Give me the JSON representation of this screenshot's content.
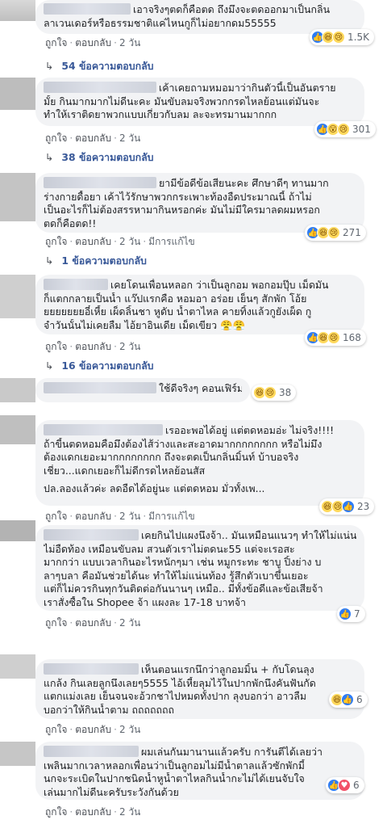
{
  "comments": [
    {
      "lines": [
        "เอาจริงๆตดก็คือตด ถึงมึงจะตดออกมาเป็นกลิ่น",
        "ลาเวนเดอร์หรือธรรมชาติแค่ไหนกูก็ไม่อยากดม55555"
      ],
      "actions": {
        "like": "ถูกใจ",
        "reply": "ตอบกลับ",
        "time": "2 วัน",
        "edited": ""
      },
      "reaction_count": "1.5K",
      "reactions": [
        "like",
        "haha",
        "sad"
      ],
      "replies": "54 ข้อความตอบกลับ"
    },
    {
      "lines": [
        "เค้าเคยถามหมอมาว่ากินตัวนี้เป็นอันตราย",
        "มั้ย กินมากมากไม่ดีนะคะ มันขับลมจริงพวกกรดไหลย้อนแต่มันจะ",
        "ทำให้เราติดยาพวกแบบเกี่ยวกับลม ละจะทรมานมากกก"
      ],
      "actions": {
        "like": "ถูกใจ",
        "reply": "ตอบกลับ",
        "time": "2 วัน",
        "edited": ""
      },
      "reaction_count": "301",
      "reactions": [
        "like",
        "wow",
        "sad"
      ],
      "replies": "38 ข้อความตอบกลับ"
    },
    {
      "lines": [
        "ยามีข้อดีข้อเสียนะคะ ศึกษาดีๆ ทานมาก",
        "ร่างกายดื้อยา เค้าไว้รักษาพวกกระเพาะท้องอืดประมาณนี้ ถ้าไม่",
        "เป็นอะไรก็ไม่ต้องสรรหามากินหรอกค่ะ มันไม่มีใครมาลดผมหรอก",
        "ตดก็คือตด!!"
      ],
      "actions": {
        "like": "ถูกใจ",
        "reply": "ตอบกลับ",
        "time": "2 วัน",
        "edited": "มีการแก้ไข"
      },
      "reaction_count": "271",
      "reactions": [
        "like",
        "haha",
        "sad"
      ],
      "replies": "1 ข้อความตอบกลับ"
    },
    {
      "lines": [
        "เคยโดนเพื่อนหลอก ว่าเป็นลูกอม พอกอมปุ๊บ เม็ดมัน",
        "ก็แตกกลายเป็นน้ำ แว๊ปแรกคือ หอมอา อร่อย เย็นๆ สักพัก โอ้ย",
        "ยยยยยยยอี๋เหี้ย เผ็ดลิ้นชา หูดับ น้ำตาไหล คายทิ้งแล้วกูยังเผ็ด กู",
        "จำวันนั้นไม่เคยลืม ไอ้ยาอินเดีย เม็ดเขียว 😤😤"
      ],
      "actions": {
        "like": "ถูกใจ",
        "reply": "ตอบกลับ",
        "time": "2 วัน",
        "edited": ""
      },
      "reaction_count": "168",
      "reactions": [
        "like",
        "haha",
        "sad"
      ],
      "replies": "16 ข้อความตอบกลับ"
    },
    {
      "lines": [
        "ใช้ดีจริงๆ คอนเฟิร์ม!"
      ],
      "actions": {
        "like": "",
        "reply": "",
        "time": "",
        "edited": ""
      },
      "reaction_count": "38",
      "reactions": [
        "haha",
        "sad"
      ],
      "replies": ""
    },
    {
      "lines": [
        "เรออะพอได้อยู่ แต่ตดหอมอ่ะ ไม่จริง!!!!",
        "ถ้าขี้นตดหอมคือมึงต้องไส้ว่างและสะอาดมากกกกกกกก หรือไม่มึง",
        "ต้องแดกเยอะมากกกกกกกก ถึงจะตดเป็นกลิ่นมิ้นท์ บ้าบอจริง",
        "เชี่ยว...แดกเยอะก็ไม่ดีกรดไหลย้อนสัส",
        "",
        "ปล.ลองแล้วค่ะ ลดอืดได้อยู่นะ แต่ตดหอม มั่วทั้งเพ..."
      ],
      "actions": {
        "like": "ถูกใจ",
        "reply": "ตอบกลับ",
        "time": "2 วัน",
        "edited": "มีการแก้ไข"
      },
      "reaction_count": "23",
      "reactions": [
        "haha",
        "sad",
        "like"
      ],
      "replies": ""
    },
    {
      "lines": [
        "เคยกินไปแผงนึงจ้า.. มันเหมือนแนวๆ ทำให้ไม่แน่น",
        "ไม่อืดท้อง เหมือนขับลม สวนตัวเราไม่ตดนะ55 แต่จะเรอสะ",
        "มากกว่า แบบเวลากินอะไรหนักๆมา เช่น หมูกระทะ ชาบู ปิ้งย่าง บ",
        "ลาๆบลา คือมันช่วยได้นะ ทำให้ไม่แน่นท้อง รู้สึกตัวเบาขึ้นเยอะ",
        "แต่ก็ไม่ควรกินทุกวันติดต่อกันนานๆ เหมือ.. มีทั้งข้อดีและข้อเสียจ้า",
        "เราสั่งซื้อใน Shopee จ้า แผงละ 17-18 บาทจ้า"
      ],
      "actions": {
        "like": "ถูกใจ",
        "reply": "ตอบกลับ",
        "time": "2 วัน",
        "edited": ""
      },
      "reaction_count": "7",
      "reactions": [
        "like"
      ],
      "replies": ""
    },
    {
      "lines": [
        "เห็นตอนแรกนึกว่าลูกอมมิ้น + กับโดนลุง",
        "แกล้ง กินเลยลูกนึงเลยๆ5555 ไอ้เหี้ยลุมไว้ในปากพักนึงคันฟันกัด",
        "แตกแม่งเลย เย็นจนจะอ้วกชาไปหมดทั้งปาก ลุงบอกว่า อาวลืม",
        "บอกว่าให้กินน้ำตาม ถถถถถถถ"
      ],
      "actions": {
        "like": "ถูกใจ",
        "reply": "ตอบกลับ",
        "time": "2 วัน",
        "edited": ""
      },
      "reaction_count": "6",
      "reactions": [
        "haha",
        "like"
      ],
      "replies": ""
    },
    {
      "lines": [
        "ผมเล่นกันมานานแล้วครับ การันตีได้เลยว่า",
        "เพลินมากเวลาหลอกเพื่อนว่าเป็นลูกอมไม่มีน้ำตาลแล้วซักพักมี้",
        "นกจะระเบิดในปากชนิดน้ำหูน้ำตาไหลกินน้ำกะไม่ได้เยนจับใจ",
        "เล่นมากไม่ดีนะครับระวังกันด้วย"
      ],
      "actions": {
        "like": "ถูกใจ",
        "reply": "ตอบกลับ",
        "time": "2 วัน",
        "edited": ""
      },
      "reaction_count": "6",
      "reactions": [
        "like",
        "love"
      ],
      "replies": ""
    }
  ],
  "colors": {
    "bubble": "#f2f3f5",
    "link": "#385898",
    "like": "#2d7cf6",
    "love": "#f25268",
    "haha": "#ffd95c"
  }
}
